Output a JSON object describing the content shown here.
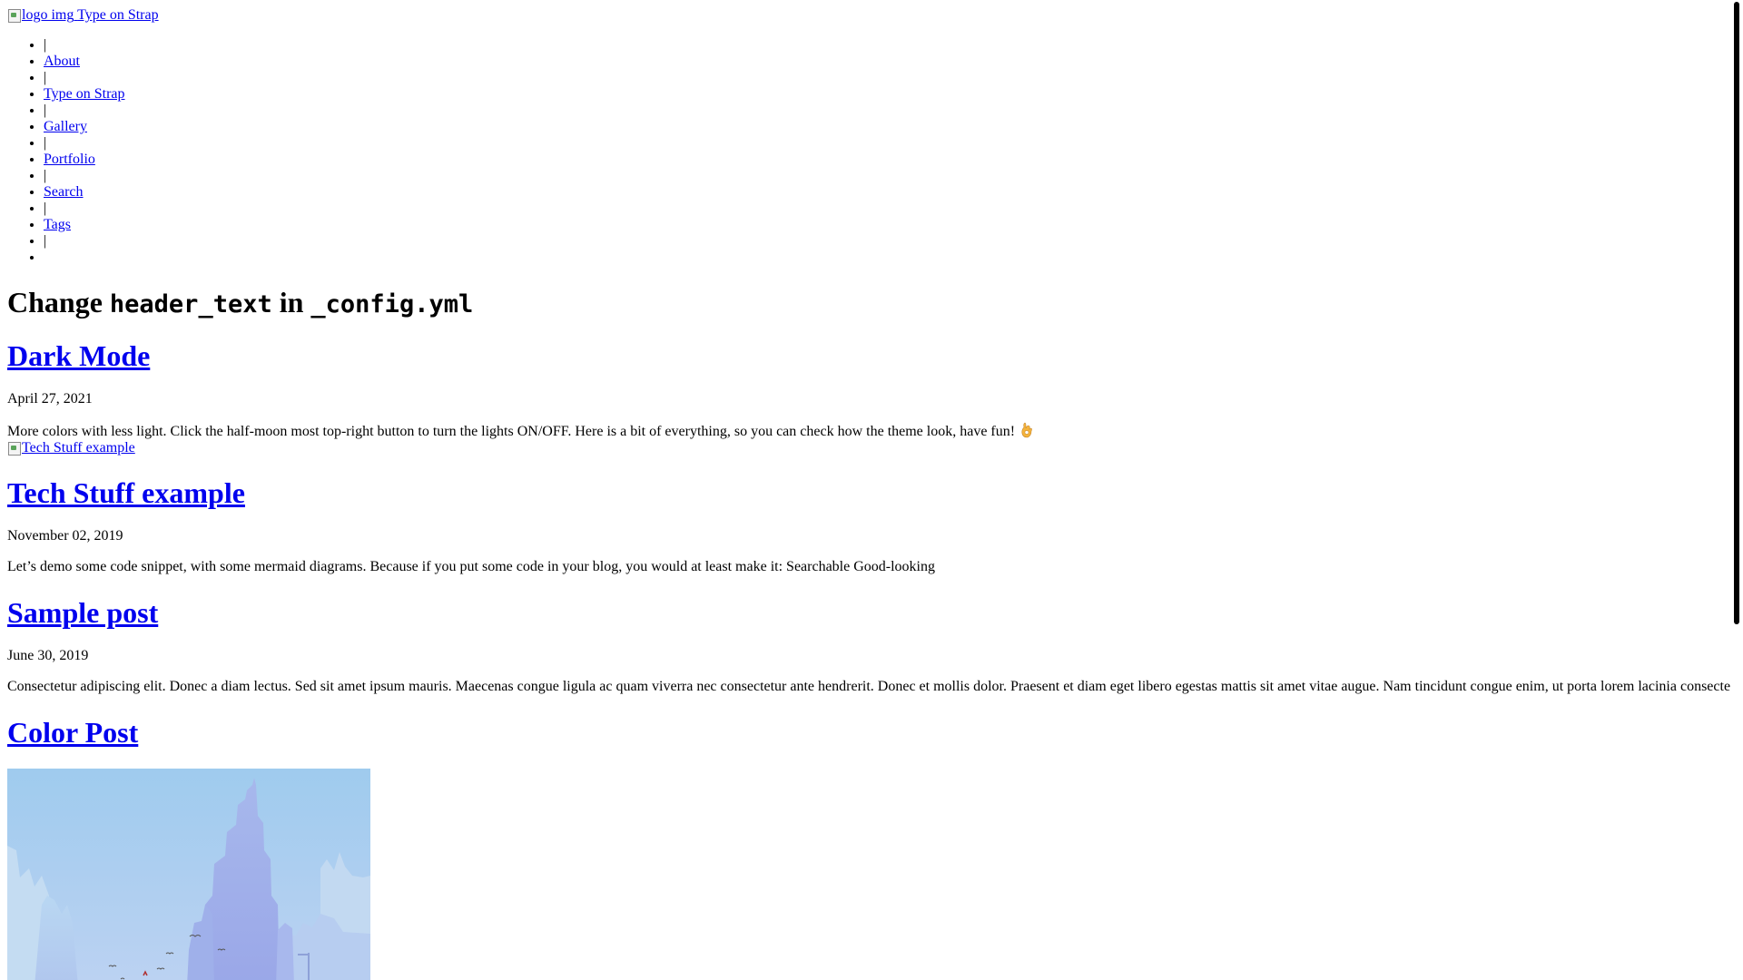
{
  "site": {
    "logo_alt": "logo img",
    "title": "Type on Strap"
  },
  "nav": {
    "separator": "|",
    "items": [
      {
        "label": "About"
      },
      {
        "label": "Type on Strap"
      },
      {
        "label": "Gallery"
      },
      {
        "label": "Portfolio"
      },
      {
        "label": "Search"
      },
      {
        "label": "Tags"
      }
    ]
  },
  "header": {
    "prefix": "Change ",
    "code1": "header_text",
    "middle": " in ",
    "code2": "_config.yml"
  },
  "posts": [
    {
      "title": "Dark Mode",
      "date": "April 27, 2021",
      "excerpt": "More colors with less light. Click the half-moon most top-right button to turn the lights ON/OFF. Here is a bit of everything, so you can check how the theme look, have fun!",
      "emoji": "ok-hand-icon"
    },
    {
      "thumbnail_alt": "Tech Stuff example",
      "title": "Tech Stuff example",
      "date": "November 02, 2019",
      "excerpt": "Let’s demo some code snippet, with some mermaid diagrams. Because if you put some code in your blog, you would at least make it: Searchable Good-looking"
    },
    {
      "title": "Sample post",
      "date": "June 30, 2019",
      "excerpt": "Consectetur adipiscing elit. Donec a diam lectus. Sed sit amet ipsum mauris. Maecenas congue ligula ac quam viverra nec consectetur ante hendrerit. Donec et mollis dolor. Praesent et diam eget libero egestas mattis sit amet vitae augue. Nam tincidunt congue enim, ut porta lorem lacinia consectetur."
    },
    {
      "title": "Color Post",
      "image": "city-skyline-illustration"
    }
  ],
  "colors": {
    "link": "#0000ee",
    "text": "#000000",
    "background": "#ffffff"
  }
}
